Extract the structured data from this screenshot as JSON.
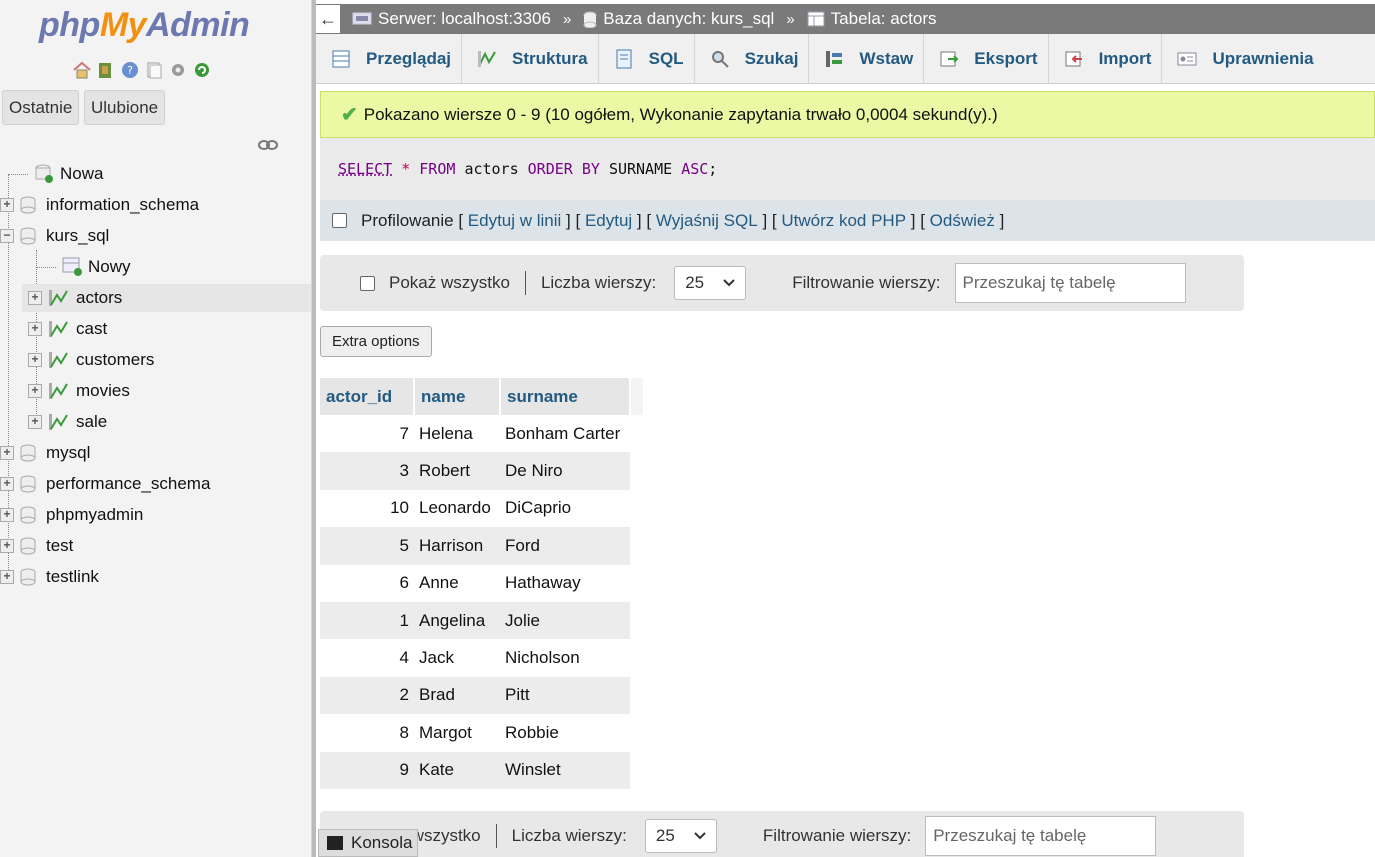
{
  "nav": {
    "logo": {
      "php": "php",
      "my": "My",
      "admin": "Admin"
    },
    "buttons": {
      "recent": "Ostatnie",
      "favorites": "Ulubione"
    },
    "tree": [
      {
        "label": "Nowa",
        "level": 0,
        "kind": "new"
      },
      {
        "label": "information_schema",
        "level": 0,
        "kind": "db",
        "expanded": false
      },
      {
        "label": "kurs_sql",
        "level": 0,
        "kind": "db",
        "expanded": true
      },
      {
        "label": "Nowy",
        "level": 1,
        "kind": "new-table"
      },
      {
        "label": "actors",
        "level": 1,
        "kind": "table",
        "selected": true
      },
      {
        "label": "cast",
        "level": 1,
        "kind": "table"
      },
      {
        "label": "customers",
        "level": 1,
        "kind": "table"
      },
      {
        "label": "movies",
        "level": 1,
        "kind": "table"
      },
      {
        "label": "sale",
        "level": 1,
        "kind": "table"
      },
      {
        "label": "mysql",
        "level": 0,
        "kind": "db"
      },
      {
        "label": "performance_schema",
        "level": 0,
        "kind": "db"
      },
      {
        "label": "phpmyadmin",
        "level": 0,
        "kind": "db"
      },
      {
        "label": "test",
        "level": 0,
        "kind": "db"
      },
      {
        "label": "testlink",
        "level": 0,
        "kind": "db"
      }
    ]
  },
  "breadcrumb": {
    "back": "←",
    "server": "Serwer: localhost:3306",
    "database": "Baza danych: kurs_sql",
    "table": "Tabela: actors",
    "separator": "»"
  },
  "tabs": [
    "Przeglądaj",
    "Struktura",
    "SQL",
    "Szukaj",
    "Wstaw",
    "Eksport",
    "Import",
    "Uprawnienia"
  ],
  "success_message": "Pokazano wiersze 0 - 9 (10 ogółem, Wykonanie zapytania trwało 0,0004 sekund(y).)",
  "sql": {
    "select": "SELECT",
    "star": "*",
    "from": "FROM",
    "table": "actors",
    "order": "ORDER BY",
    "column": "SURNAME",
    "asc": "ASC",
    "end": ";"
  },
  "profiling": {
    "label": "Profilowanie",
    "links": [
      "Edytuj w linii",
      "Edytuj",
      "Wyjaśnij SQL",
      "Utwórz kod PHP",
      "Odśwież"
    ]
  },
  "navbar": {
    "show_all": "Pokaż wszystko",
    "show_all_bottom": "ąż wszystko",
    "rows_label": "Liczba wierszy:",
    "rows_value": "25",
    "filter_label": "Filtrowanie wierszy:",
    "filter_placeholder": "Przeszukaj tę tabelę"
  },
  "extra_options": "Extra options",
  "table": {
    "columns": [
      "actor_id",
      "name",
      "surname"
    ],
    "rows": [
      [
        "7",
        "Helena",
        "Bonham Carter"
      ],
      [
        "3",
        "Robert",
        "De Niro"
      ],
      [
        "10",
        "Leonardo",
        "DiCaprio"
      ],
      [
        "5",
        "Harrison",
        "Ford"
      ],
      [
        "6",
        "Anne",
        "Hathaway"
      ],
      [
        "1",
        "Angelina",
        "Jolie"
      ],
      [
        "4",
        "Jack",
        "Nicholson"
      ],
      [
        "2",
        "Brad",
        "Pitt"
      ],
      [
        "8",
        "Margot",
        "Robbie"
      ],
      [
        "9",
        "Kate",
        "Winslet"
      ]
    ]
  },
  "console": "Konsola",
  "colors": {
    "link": "#235a81",
    "success_bg": "#ebf8a4",
    "logo_blue": "#6c78af",
    "logo_orange": "#f29111"
  }
}
